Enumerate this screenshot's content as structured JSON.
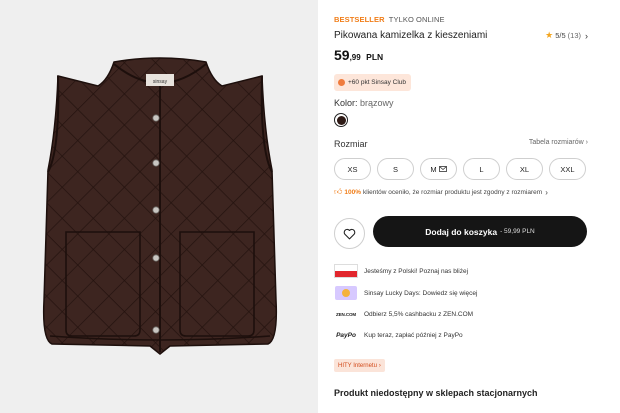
{
  "product": {
    "badge_bestseller": "BESTSELLER",
    "badge_online": "TYLKO ONLINE",
    "title": "Pikowana kamizelka z kieszeniami",
    "rating": {
      "score": "5/5",
      "count": "(13)",
      "stars_filled": 1
    },
    "price": {
      "main": "59",
      "decimals": ",99",
      "currency": "PLN"
    },
    "club_points": "+60 pkt Sinsay Club",
    "color_label": "Kolor:",
    "color_value": "brązowy",
    "swatch_color": "#2e1a16",
    "size_label": "Rozmiar",
    "size_guide": "Tabela rozmiarów",
    "sizes": [
      "XS",
      "S",
      "M",
      "L",
      "XL",
      "XXL"
    ],
    "fit_percent": "100%",
    "fit_text": "klientów oceniło, że rozmiar produktu jest zgodny z rozmiarem",
    "add_to_cart": "Dodaj do koszyka",
    "add_to_cart_price": "- 59,99 PLN",
    "promos": [
      {
        "icon": "poland-flag-icon",
        "text": "Jesteśmy z Polski! Poznaj nas bliżej"
      },
      {
        "icon": "sinsay-lucky-days-icon",
        "text": "Sinsay Lucky Days: Dowiedz się więcej"
      },
      {
        "icon": "zen-logo-icon",
        "icon_text": "ZEN.COM",
        "text": "Odbierz 5,5% cashbacku z ZEN.COM"
      },
      {
        "icon": "paypo-logo-icon",
        "icon_text": "PayPo",
        "text": "Kup teraz, zapłać później z PayPo"
      }
    ],
    "hity_tag": "HITY Internetu",
    "availability": "Produkt niedostępny w sklepach stacjonarnych",
    "vest_label_text": "sinsay"
  },
  "colors": {
    "accent": "#f07d18",
    "button_bg": "#151515",
    "club_bg": "#fde6da",
    "hity_text": "#d24a1a"
  }
}
